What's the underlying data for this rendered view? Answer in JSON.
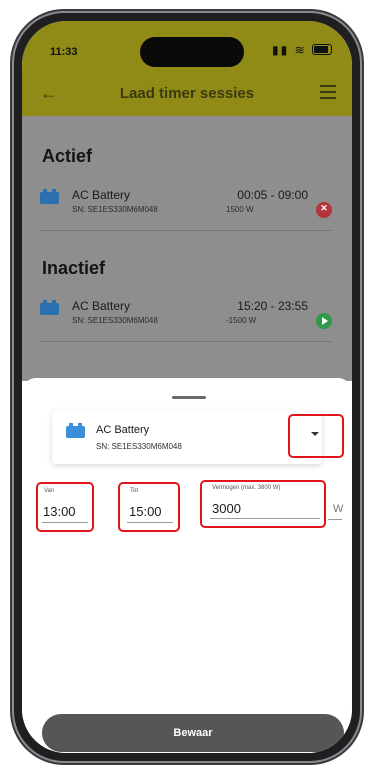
{
  "status_bar": {
    "time": "11:33",
    "signal_icon": "signal-icon",
    "wifi_icon": "wifi-icon",
    "battery_icon": "battery-icon"
  },
  "header": {
    "title": "Laad timer sessies",
    "back_icon": "back-arrow-icon",
    "menu_icon": "menu-icon"
  },
  "colors": {
    "header": "#8f8b16",
    "overlay": "#8e8e8e",
    "highlight": "#e0161b",
    "stop": "#b4323a",
    "play": "#2f9a4a",
    "battery_icon": "#2a6fae",
    "save_button": "#565656"
  },
  "active": {
    "title": "Actief",
    "sessions": [
      {
        "name": "AC Battery",
        "sn": "SN: SE1ES330M6M048",
        "time": "00:05 - 09:00",
        "power": "1500 W",
        "action_icon": "stop-icon"
      }
    ]
  },
  "inactive": {
    "title": "Inactief",
    "sessions": [
      {
        "name": "AC Battery",
        "sn": "SN: SE1ES330M6M048",
        "time": "15:20 - 23:55",
        "power": "-1500 W",
        "action_icon": "play-icon"
      }
    ]
  },
  "sheet": {
    "device": {
      "name": "AC Battery",
      "sn": "SN: SE1ES330M6M048",
      "dropdown_icon": "chevron-down-icon"
    },
    "fields": {
      "from": {
        "label": "Van",
        "value": "13:00"
      },
      "to": {
        "label": "Tot",
        "value": "15:00"
      },
      "power": {
        "label": "Vermogen (max. 3800 W)",
        "value": "3000",
        "unit": "W"
      }
    },
    "save_label": "Bewaar"
  }
}
